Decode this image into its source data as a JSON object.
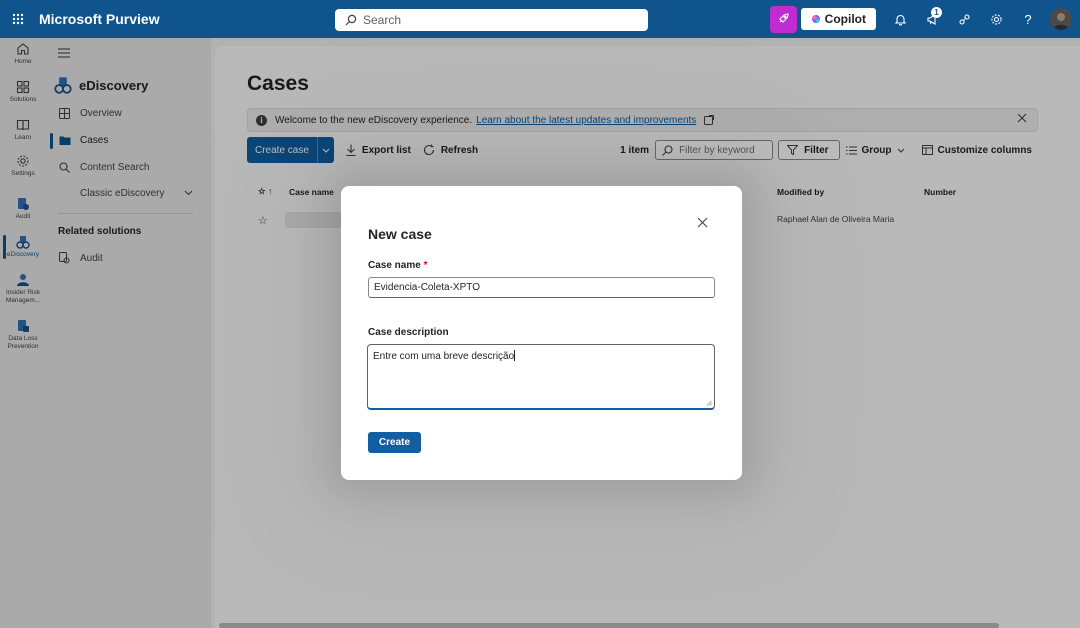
{
  "app": {
    "title": "Microsoft Purview"
  },
  "topbar": {
    "search_placeholder": "Search",
    "copilot_label": "Copilot",
    "notification_count": "1"
  },
  "rail": {
    "items": [
      {
        "label": "Home",
        "icon": "home-icon"
      },
      {
        "label": "Solutions",
        "icon": "solutions-icon"
      },
      {
        "label": "Learn",
        "icon": "learn-icon"
      },
      {
        "label": "Settings",
        "icon": "settings-icon"
      },
      {
        "label": "Audit",
        "icon": "audit-icon"
      },
      {
        "label": "eDiscovery",
        "icon": "ediscovery-icon"
      },
      {
        "label": "Insider Risk Managem...",
        "icon": "insider-risk-icon"
      },
      {
        "label": "Data Loss Prevention",
        "icon": "dlp-icon"
      }
    ]
  },
  "nav": {
    "header": "eDiscovery",
    "items": [
      {
        "label": "Overview"
      },
      {
        "label": "Cases"
      },
      {
        "label": "Content Search"
      },
      {
        "label": "Classic eDiscovery"
      }
    ],
    "related_heading": "Related solutions",
    "related_items": [
      {
        "label": "Audit"
      }
    ]
  },
  "main": {
    "title": "Cases",
    "banner": {
      "text": "Welcome to the new eDiscovery experience.",
      "link": "Learn about the latest updates and improvements"
    },
    "toolbar": {
      "create_case": "Create case",
      "export_list": "Export list",
      "refresh": "Refresh",
      "item_count": "1 item",
      "filter_placeholder": "Filter by keyword",
      "filter": "Filter",
      "group": "Group",
      "customize_columns": "Customize columns"
    },
    "table": {
      "columns": [
        "Case name",
        "Modified by",
        "Number"
      ],
      "rows": [
        {
          "modified_by": "Raphael Alan de Oliveira Maria"
        }
      ]
    }
  },
  "dialog": {
    "title": "New case",
    "case_name_label": "Case name",
    "required_mark": "*",
    "case_name_value": "Evidencia-Coleta-XPTO",
    "case_description_label": "Case description",
    "case_description_value": "Entre com uma breve descrição",
    "create_button": "Create"
  }
}
